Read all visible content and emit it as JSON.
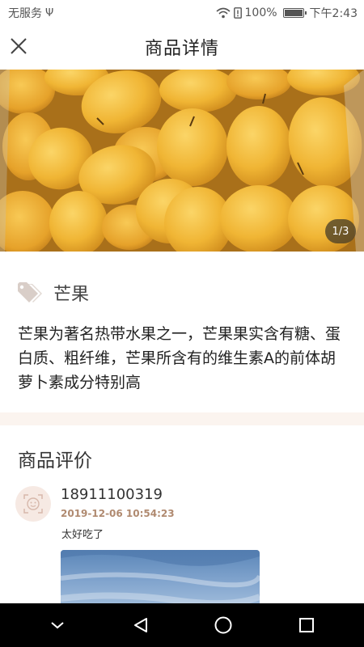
{
  "status_bar": {
    "carrier": "无服务",
    "usb_symbol": "Ψ",
    "battery": "100%",
    "battery_level": 1.0,
    "time": "下午2:43"
  },
  "header": {
    "title": "商品详情"
  },
  "hero": {
    "counter": "1/3"
  },
  "product": {
    "name": "芒果",
    "description": "芒果为著名热带水果之一，芒果果实含有糖、蛋白质、粗纤维，芒果所含有的维生素A的前体胡萝卜素成分特别高"
  },
  "reviews": {
    "title": "商品评价",
    "items": [
      {
        "user": "18911100319",
        "time": "2019-12-06 10:54:23",
        "text": "太好吃了"
      }
    ]
  },
  "colors": {
    "accent": "#b08a70",
    "divider": "#fbf4ef",
    "mango": "#e9b640"
  },
  "icons": {
    "close": "close-icon",
    "tag": "tag-icon",
    "avatar": "avatar-placeholder-icon",
    "wifi": "wifi-icon",
    "battery": "battery-icon",
    "back": "nav-back-icon",
    "home": "nav-home-icon",
    "recent": "nav-recent-icon",
    "hide": "nav-hide-icon"
  }
}
